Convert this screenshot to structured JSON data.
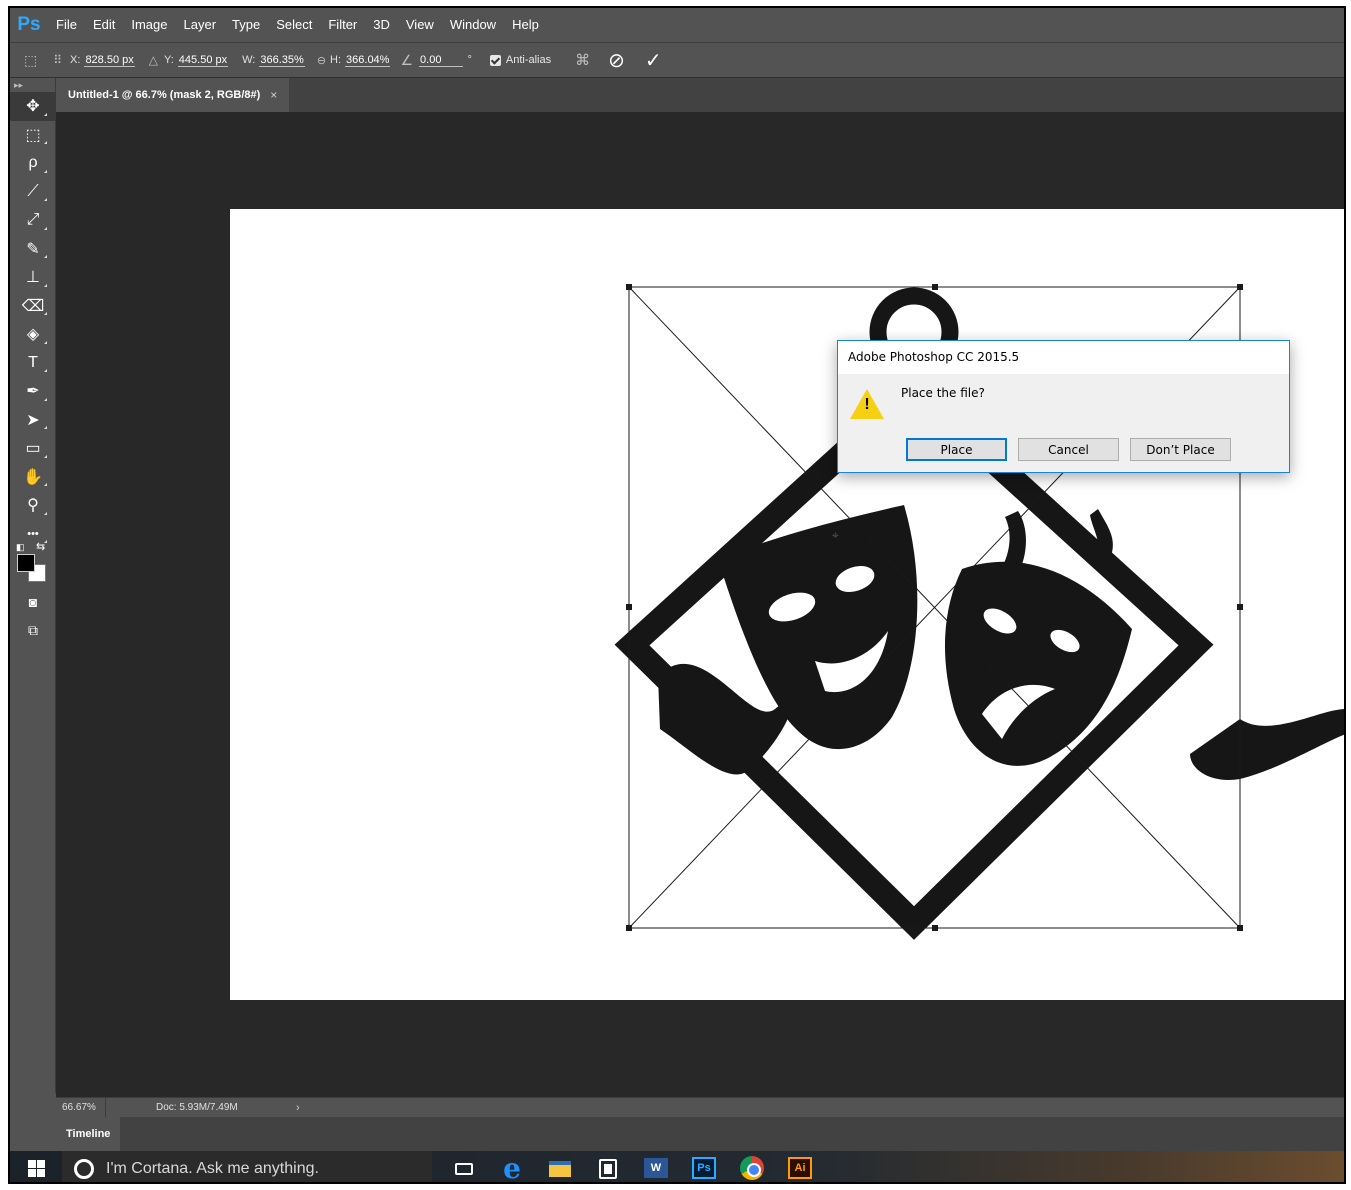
{
  "app": {
    "logo": "Ps",
    "menu": [
      "File",
      "Edit",
      "Image",
      "Layer",
      "Type",
      "Select",
      "Filter",
      "3D",
      "View",
      "Window",
      "Help"
    ]
  },
  "options": {
    "x_label": "X:",
    "x_value": "828.50 px",
    "y_label": "Y:",
    "y_value": "445.50 px",
    "w_label": "W:",
    "w_value": "366.35%",
    "h_label": "H:",
    "h_value": "366.04%",
    "angle_value": "0.00",
    "angle_unit": "°",
    "antialias_label": "Anti-alias",
    "cancel_icon": "cancel-transform-icon",
    "commit_icon": "commit-transform-icon"
  },
  "document": {
    "tab_title": "Untitled-1 @ 66.7% (mask 2, RGB/8#)",
    "tab_close": "×"
  },
  "tools": [
    {
      "name": "move-tool",
      "glyph": "✥"
    },
    {
      "name": "marquee-tool",
      "glyph": "⬚"
    },
    {
      "name": "lasso-tool",
      "glyph": "ρ"
    },
    {
      "name": "quick-selection-tool",
      "glyph": "⟋"
    },
    {
      "name": "eyedropper-tool",
      "glyph": "⤢"
    },
    {
      "name": "brush-tool",
      "glyph": "✎"
    },
    {
      "name": "clone-stamp-tool",
      "glyph": "⊥"
    },
    {
      "name": "eraser-tool",
      "glyph": "⌫"
    },
    {
      "name": "paint-bucket-tool",
      "glyph": "◈"
    },
    {
      "name": "type-tool",
      "glyph": "T"
    },
    {
      "name": "pen-tool",
      "glyph": "✒"
    },
    {
      "name": "path-selection-tool",
      "glyph": "➤"
    },
    {
      "name": "rectangle-tool",
      "glyph": "▭"
    },
    {
      "name": "hand-tool",
      "glyph": "✋"
    },
    {
      "name": "zoom-tool",
      "glyph": "⚲"
    },
    {
      "name": "more-tools",
      "glyph": "•••"
    }
  ],
  "status": {
    "zoom": "66.67%",
    "doc_info": "Doc: 5.93M/7.49M",
    "arrow": "›"
  },
  "panels": {
    "timeline_tab": "Timeline"
  },
  "dialog": {
    "title": "Adobe Photoshop CC 2015.5",
    "message": "Place the file?",
    "icon": "warning-icon",
    "buttons": {
      "place": "Place",
      "cancel": "Cancel",
      "dont_place": "Don’t Place"
    }
  },
  "taskbar": {
    "search_placeholder": "I'm Cortana. Ask me anything.",
    "word_label": "W",
    "ps_label": "Ps",
    "ai_label": "Ai"
  },
  "colors": {
    "ps_blue": "#31a8ff",
    "chrome_gray": "#535353",
    "canvas_bg": "#282828",
    "dialog_border": "#1883d7",
    "warning_yellow": "#f7d013"
  }
}
